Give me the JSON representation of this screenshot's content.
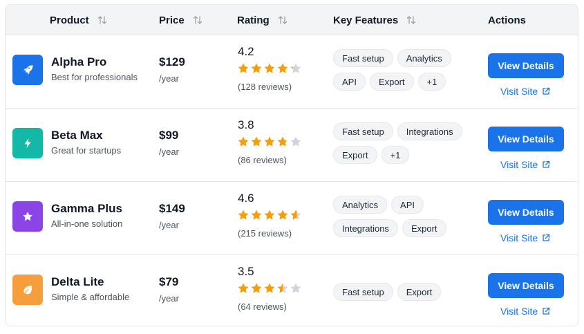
{
  "header": {
    "product": "Product",
    "price": "Price",
    "rating": "Rating",
    "features": "Key Features",
    "actions": "Actions"
  },
  "rows": [
    {
      "name": "Alpha Pro",
      "tagline": "Best for professionals",
      "price": "$129",
      "period": "/year",
      "rating": "4.2",
      "stars": 4.2,
      "reviews": "(128 reviews)",
      "icon": "rocket-icon",
      "icon_color": "#1a73e8",
      "features": [
        "Fast setup",
        "Analytics",
        "API",
        "Export",
        "+1"
      ],
      "view_label": "View Details",
      "visit_label": "Visit Site"
    },
    {
      "name": "Beta Max",
      "tagline": "Great for startups",
      "price": "$99",
      "period": "/year",
      "rating": "3.8",
      "stars": 3.8,
      "reviews": "(86 reviews)",
      "icon": "lightning-icon",
      "icon_color": "#14b8a6",
      "features": [
        "Fast setup",
        "Integrations",
        "Export",
        "+1"
      ],
      "view_label": "View Details",
      "visit_label": "Visit Site"
    },
    {
      "name": "Gamma Plus",
      "tagline": "All-in-one solution",
      "price": "$149",
      "period": "/year",
      "rating": "4.6",
      "stars": 4.6,
      "reviews": "(215 reviews)",
      "icon": "star-icon",
      "icon_color": "#8b45e6",
      "features": [
        "Analytics",
        "API",
        "Integrations",
        "Export"
      ],
      "view_label": "View Details",
      "visit_label": "Visit Site"
    },
    {
      "name": "Delta Lite",
      "tagline": "Simple & affordable",
      "price": "$79",
      "period": "/year",
      "rating": "3.5",
      "stars": 3.5,
      "reviews": "(64 reviews)",
      "icon": "leaf-icon",
      "icon_color": "#f59e3b",
      "features": [
        "Fast setup",
        "Export"
      ],
      "view_label": "View Details",
      "visit_label": "Visit Site"
    }
  ],
  "colors": {
    "accent": "#1a73e8",
    "star_filled": "#f59e0b",
    "star_empty": "#d1d5db"
  }
}
